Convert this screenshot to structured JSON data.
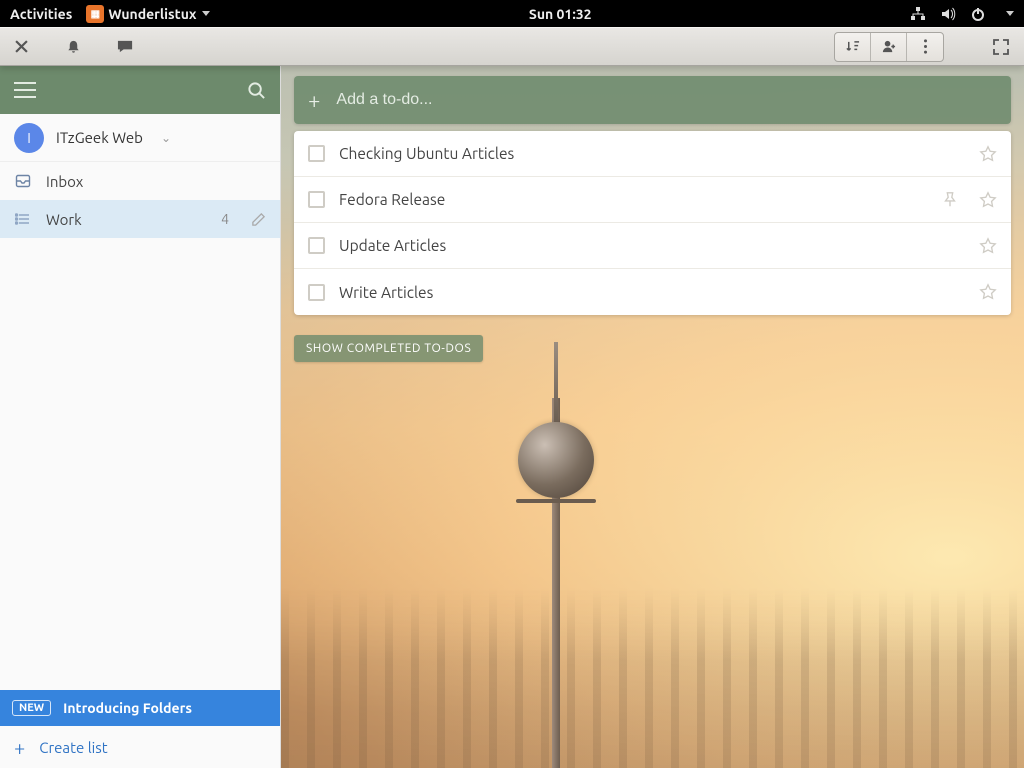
{
  "gnome": {
    "activities": "Activities",
    "app_name": "Wunderlistux",
    "clock": "Sun 01:32"
  },
  "titlebar": {},
  "sidebar": {
    "account": {
      "initial": "I",
      "name": "ITzGeek Web"
    },
    "lists": [
      {
        "label": "Inbox",
        "count": "",
        "active": false
      },
      {
        "label": "Work",
        "count": "4",
        "active": true
      }
    ],
    "intro": {
      "badge": "NEW",
      "text": "Introducing Folders"
    },
    "create_label": "Create list"
  },
  "main": {
    "add_placeholder": "Add a to-do...",
    "todos": [
      {
        "title": "Checking Ubuntu Articles",
        "pinned": false
      },
      {
        "title": "Fedora Release",
        "pinned": true
      },
      {
        "title": "Update Articles",
        "pinned": false
      },
      {
        "title": "Write Articles",
        "pinned": false
      }
    ],
    "show_completed": "SHOW COMPLETED TO-DOS"
  }
}
